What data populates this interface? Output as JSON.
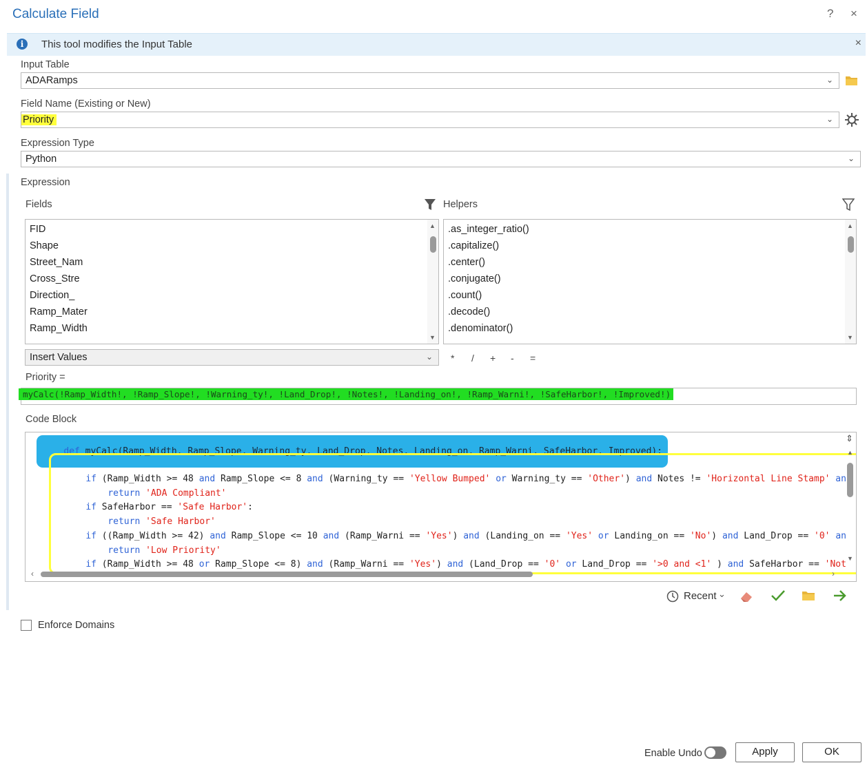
{
  "window": {
    "title": "Calculate Field",
    "help": "?",
    "close": "×"
  },
  "info_bar": {
    "icon": "i",
    "text": "This tool modifies the Input Table",
    "close": "×"
  },
  "input_table": {
    "label": "Input Table",
    "value": "ADARamps"
  },
  "field_name": {
    "label": "Field Name (Existing or New)",
    "value": "Priority"
  },
  "expression_type": {
    "label": "Expression Type",
    "value": "Python"
  },
  "expression": {
    "label": "Expression",
    "fields_label": "Fields",
    "helpers_label": "Helpers",
    "fields": [
      "FID",
      "Shape",
      "Street_Nam",
      "Cross_Stre",
      "Direction_",
      "Ramp_Mater",
      "Ramp_Width"
    ],
    "helpers": [
      ".as_integer_ratio()",
      ".capitalize()",
      ".center()",
      ".conjugate()",
      ".count()",
      ".decode()",
      ".denominator()"
    ],
    "insert_values": "Insert Values",
    "operators": [
      "*",
      "/",
      "+",
      "-",
      "="
    ],
    "priority_label": "Priority =",
    "priority_value": "myCalc(!Ramp_Width!, !Ramp_Slope!, !Warning_ty!, !Land_Drop!, !Notes!, !Landing_on!, !Ramp_Warni!, !SafeHarbor!, !Improved!)"
  },
  "code_block": {
    "label": "Code Block",
    "def_kw": "def",
    "def_rest": " myCalc(Ramp_Width, Ramp_Slope, Warning_ty, Land_Drop, Notes, Landing_on, Ramp_Warni, SafeHarbor, Improved):",
    "l1a": "if",
    "l1b": " (Ramp_Width >= 48 ",
    "l1c": "and",
    "l1d": " Ramp_Slope <= 8 ",
    "l1e": "and",
    "l1f": " (Warning_ty == ",
    "l1g": "'Yellow Bumped'",
    "l1h": " ",
    "l1i": "or",
    "l1j": " Warning_ty == ",
    "l1k": "'Other'",
    "l1l": ") ",
    "l1m": "and",
    "l1n": " Notes != ",
    "l1o": "'Horizontal Line Stamp'",
    "l1p": " an",
    "l2a": "return",
    "l2b": "'ADA Compliant'",
    "l3a": "if",
    "l3b": " SafeHarbor == ",
    "l3c": "'Safe Harbor'",
    "l3d": ":",
    "l4a": "return",
    "l4b": "'Safe Harbor'",
    "l5a": "if",
    "l5b": " ((Ramp_Width >= 42) ",
    "l5c": "and",
    "l5d": " Ramp_Slope <= 10 ",
    "l5e": "and",
    "l5f": " (Ramp_Warni == ",
    "l5g": "'Yes'",
    "l5h": ") ",
    "l5i": "and",
    "l5j": " (Landing_on == ",
    "l5k": "'Yes'",
    "l5l": " ",
    "l5m": "or",
    "l5n": " Landing_on == ",
    "l5o": "'No'",
    "l5p": ") ",
    "l5q": "and",
    "l5r": " Land_Drop == ",
    "l5s": "'0'",
    "l5t": " an",
    "l6a": "return",
    "l6b": "'Low Priority'",
    "l7a": "if",
    "l7b": " (Ramp_Width >= 48 ",
    "l7c": "or",
    "l7d": " Ramp_Slope <= 8) ",
    "l7e": "and",
    "l7f": " (Ramp_Warni == ",
    "l7g": "'Yes'",
    "l7h": ") ",
    "l7i": "and",
    "l7j": " (Land_Drop == ",
    "l7k": "'0'",
    "l7l": " ",
    "l7m": "or",
    "l7n": " Land_Drop == ",
    "l7o": "'>0 and <1'",
    "l7p": " ) ",
    "l7q": "and",
    "l7r": " SafeHarbor == ",
    "l7s": "'Not"
  },
  "toolbar": {
    "recent": "Recent"
  },
  "enforce_domains": {
    "label": "Enforce Domains",
    "checked": false
  },
  "footer": {
    "enable_undo": "Enable Undo",
    "enable_undo_on": false,
    "apply": "Apply",
    "ok": "OK"
  },
  "colors": {
    "accent": "#2a6fb8",
    "highlight_yellow": "#ffff3c",
    "highlight_green": "#22dd22",
    "highlight_blue": "#2ab0e8"
  }
}
